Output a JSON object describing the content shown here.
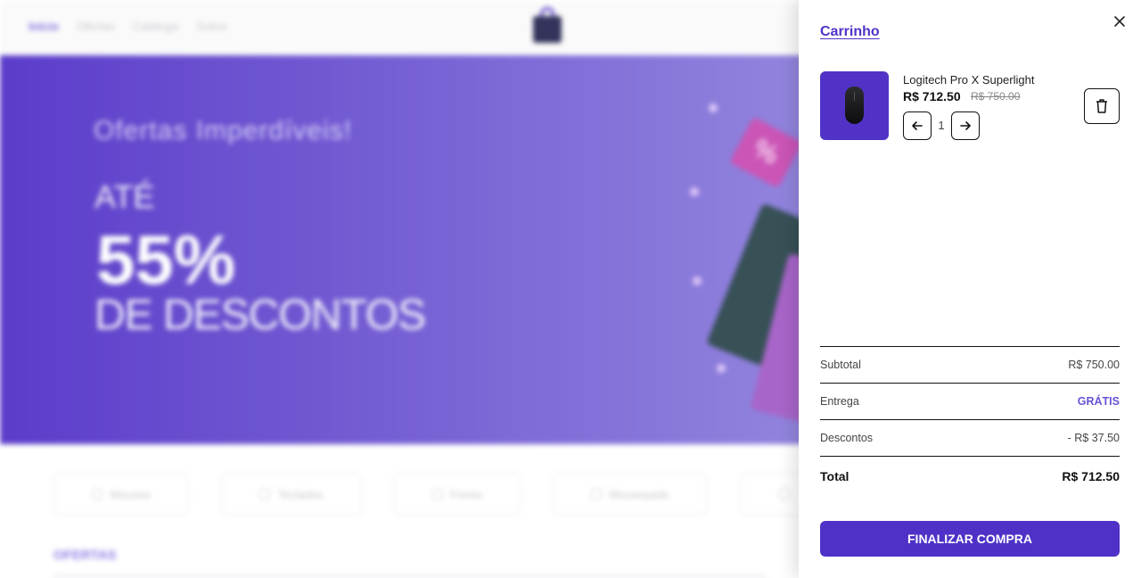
{
  "background": {
    "nav_links": [
      "Início",
      "Ofertas",
      "Catálogo",
      "Sobre"
    ],
    "hero": {
      "subtitle": "Ofertas Imperdíveis!",
      "ate": "ATÉ",
      "percent": "55%",
      "description": "DE DESCONTOS",
      "tag": "%"
    },
    "categories": [
      "Mouses",
      "Teclados",
      "Fones",
      "Mousepads"
    ],
    "section_title": "OFERTAS"
  },
  "cart": {
    "title": "Carrinho",
    "items": [
      {
        "name": "Logitech Pro X Superlight",
        "price": "R$ 712.50",
        "old_price": "R$ 750.00",
        "quantity": "1"
      }
    ],
    "summary": {
      "subtotal_label": "Subtotal",
      "subtotal_value": "R$ 750.00",
      "delivery_label": "Entrega",
      "delivery_value": "GRÁTIS",
      "discount_label": "Descontos",
      "discount_value": "- R$ 37.50",
      "total_label": "Total",
      "total_value": "R$ 712.50"
    },
    "checkout_label": "FINALIZAR COMPRA"
  },
  "colors": {
    "accent": "#4f31c7",
    "free_shipping": "#6a52d6",
    "hero_start": "#5535c8",
    "hero_end": "#b9b2ea"
  },
  "icons": [
    "close-icon",
    "arrow-left-icon",
    "arrow-right-icon",
    "trash-icon",
    "shopping-bag-icon",
    "mouse-product-image"
  ]
}
